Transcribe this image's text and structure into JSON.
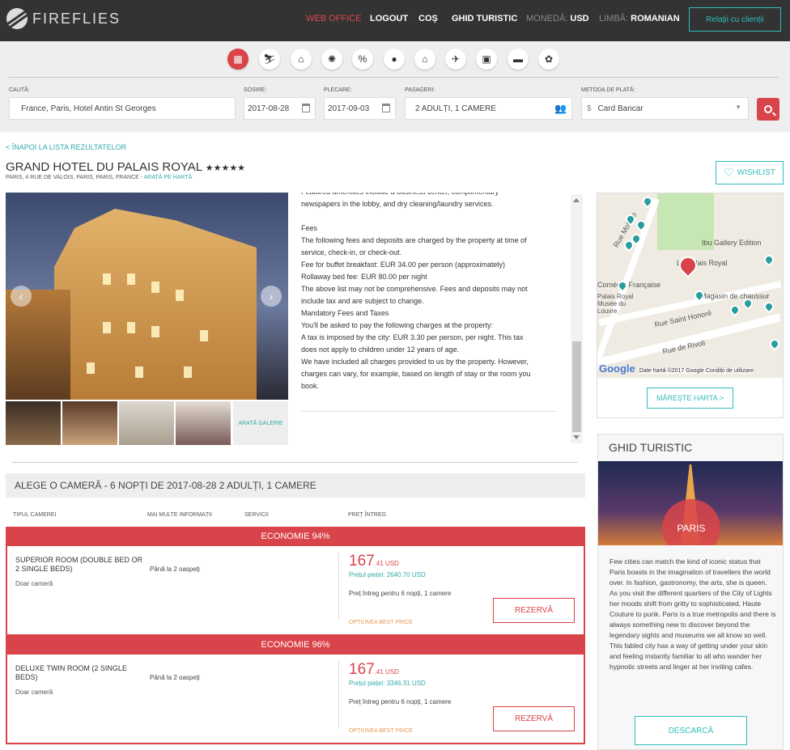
{
  "header": {
    "logo_text": "FIREFLIES",
    "nav": {
      "web_office": "WEB OFFICE",
      "logout": "LOGOUT",
      "cos": "COȘ",
      "ghid": "GHID TURISTIC",
      "moneda_label": "MONEDĂ:",
      "moneda_value": "USD",
      "limba_label": "LIMBĂ:",
      "limba_value": "ROMANIAN"
    },
    "relatii": "Relații cu clienții"
  },
  "categories": [
    {
      "icon": "hotel-icon",
      "glyph": "▦",
      "active": true
    },
    {
      "icon": "ski-icon",
      "glyph": "⛷",
      "active": false
    },
    {
      "icon": "home-icon",
      "glyph": "⌂",
      "active": false
    },
    {
      "icon": "sun-icon",
      "glyph": "✺",
      "active": false
    },
    {
      "icon": "percent-icon",
      "glyph": "%",
      "active": false
    },
    {
      "icon": "ball-icon",
      "glyph": "●",
      "active": false
    },
    {
      "icon": "museum-icon",
      "glyph": "⌂",
      "active": false
    },
    {
      "icon": "plane-icon",
      "glyph": "✈",
      "active": false
    },
    {
      "icon": "bus-icon",
      "glyph": "▣",
      "active": false
    },
    {
      "icon": "car-icon",
      "glyph": "▬",
      "active": false
    },
    {
      "icon": "flower-icon",
      "glyph": "✿",
      "active": false
    }
  ],
  "search": {
    "cauta_label": "CAUTĂ:",
    "cauta_value": "France, Paris, Hotel Antin St Georges",
    "sosire_label": "SOSIRE:",
    "sosire_value": "2017-08-28",
    "plecare_label": "PLECARE:",
    "plecare_value": "2017-09-03",
    "pasageri_label": "PASAGERI:",
    "pasageri_value": "2 ADULȚI, 1 CAMERE",
    "plata_label": "METODA DE PLATĂ:",
    "plata_currency": "$",
    "plata_value": "Card Bancar"
  },
  "hotel": {
    "back": "< ÎNAPOI LA LISTA REZULTATELOR",
    "name": "GRAND HOTEL DU PALAIS ROYAL",
    "stars": "★★★★★",
    "address": "PARIS, 4 RUE DE VALOIS, PARIS, PARIS, FRANCE - ",
    "map_link": "ARATĂ PE HARTĂ",
    "wishlist": "WISHLIST",
    "gallery_more": "ARATĂ GALERIE"
  },
  "description": [
    "Featured amenities include a business center, complimentary",
    "newspapers in the lobby, and dry cleaning/laundry services.",
    "",
    "Fees",
    "The following fees and deposits are charged by the property at time of",
    "service, check-in, or check-out.",
    "Fee for buffet breakfast: EUR 34.00 per person (approximately)",
    "Rollaway bed fee: EUR 80.00 per night",
    "The above list may not be comprehensive. Fees and deposits may not",
    "include tax and are subject to change.",
    "Mandatory Fees and Taxes",
    "You'll be asked to pay the following charges at the property:",
    "A tax is imposed by the city: EUR 3.30 per person, per night. This tax",
    "does not apply to children under 12 years of age.",
    "We have included all charges provided to us by the property. However,",
    "charges can vary, for example, based on length of stay or the room you",
    "book."
  ],
  "rooms_header": "ALEGE O CAMERĂ - 6 NOPȚI DE 2017-08-28 2 ADULȚI, 1 CAMERE",
  "columns": [
    "TIPUL CAMEREI",
    "MAI MULTE INFORMAȚII",
    "SERVICII",
    "PREȚ ÎNTREG"
  ],
  "rooms": [
    {
      "economy": "ECONOMIE 94%",
      "name": "SUPERIOR ROOM (DOUBLE BED OR 2 SINGLE BEDS)",
      "sub": "Doar cameră",
      "guests": "Până la 2 oaspeți",
      "price_int": "167",
      "price_dec": ".41 USD",
      "market": "Prețul pieței: 2640.70 USD",
      "total": "Preț întreg pentru 6 nopți, 1 camere",
      "best": "OPȚIUNEA BEST PRICE",
      "button": "REZERVĂ"
    },
    {
      "economy": "ECONOMIE 96%",
      "name": "DELUXE TWIN ROOM (2 SINGLE BEDS)",
      "sub": "Doar cameră",
      "guests": "Până la 2 oaspeți",
      "price_int": "167",
      "price_dec": ".41 USD",
      "market": "Prețul pieței: 3346.31 USD",
      "total": "Preț întreg pentru 6 nopți, 1 camere",
      "best": "OPȚIUNEA BEST PRICE",
      "button": "REZERVĂ"
    }
  ],
  "map": {
    "labels": [
      "Ibu Gallery Edition",
      "Le Palais Royal",
      "Magasin de chaussur",
      "Rue Saint Honoré",
      "Rue de Rivoli",
      "Rue Molière",
      "Palais Royal Musée du Louvre",
      "Comédie Française"
    ],
    "google": "Google",
    "footer": "Date hartă ©2017 Google   Condiții de utilizare",
    "button": "MĂREȘTE HARTA >"
  },
  "guide": {
    "title": "GHID TURISTIC",
    "city": "PARIS",
    "text": "Few cities can match the kind of iconic status that Paris boasts in the imagination of travellers the world over. In fashion, gastronomy, the arts, she is queen. As you visit the different quartiers of the City of Lights her moods shift from gritty to sophisticated, Haute Couture to punk. Paris is a true metropolis and there is always something new to discover beyond the legendary sights and museums we all know so well. This fabled city has a way of getting under your skin and feeling instantly familiar to all who wander her hypnotic streets and linger at her inviting cafes.",
    "button": "DESCARCĂ"
  },
  "colors": {
    "accent": "#d9444a",
    "teal": "#33aaaa",
    "topbar": "#333333"
  }
}
